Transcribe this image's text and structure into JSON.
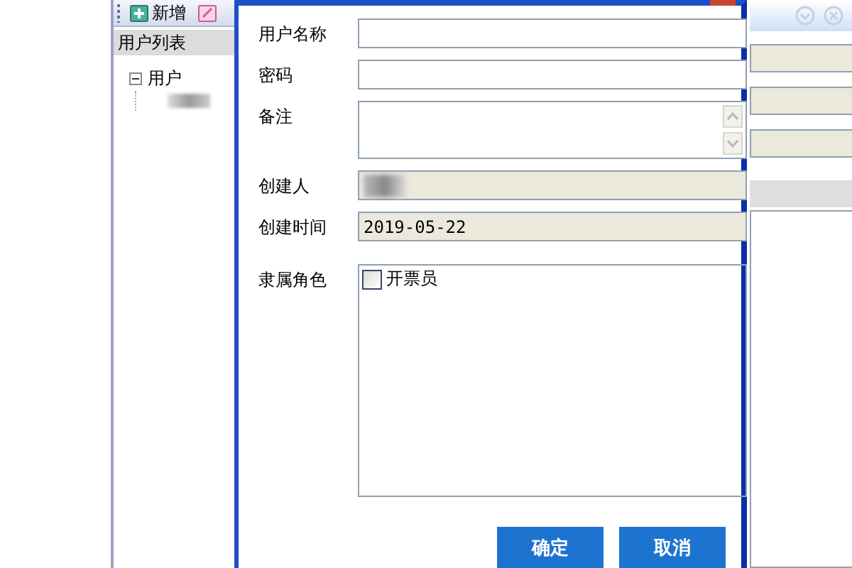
{
  "toolbar": {
    "buttons": [
      {
        "label": "新增",
        "kind": "add"
      },
      {
        "kind": "edit"
      }
    ]
  },
  "user_list": {
    "title": "用户列表",
    "tree": [
      {
        "label": "用户",
        "expanded": true,
        "children": [
          {
            "kind": "redacted"
          }
        ]
      }
    ]
  },
  "detail_panel": {
    "fields": [
      {
        "disabled": true
      },
      {
        "disabled": true
      },
      {
        "disabled": true
      }
    ]
  },
  "dialog": {
    "fields": [
      {
        "kind": "text",
        "label": "用户名称",
        "disabled": false
      },
      {
        "kind": "text",
        "label": "密码",
        "disabled": false
      },
      {
        "kind": "textarea",
        "label": "备注",
        "disabled": false
      },
      {
        "kind": "text",
        "label": "创建人",
        "disabled": true,
        "redacted": true
      },
      {
        "kind": "text",
        "label": "创建时间",
        "value": "2019-05-22",
        "disabled": true
      },
      {
        "kind": "checklist",
        "label": "隶属角色",
        "options": [
          {
            "label": "开票员",
            "checked": false
          }
        ]
      }
    ],
    "buttons": [
      "确定",
      "取消"
    ]
  }
}
